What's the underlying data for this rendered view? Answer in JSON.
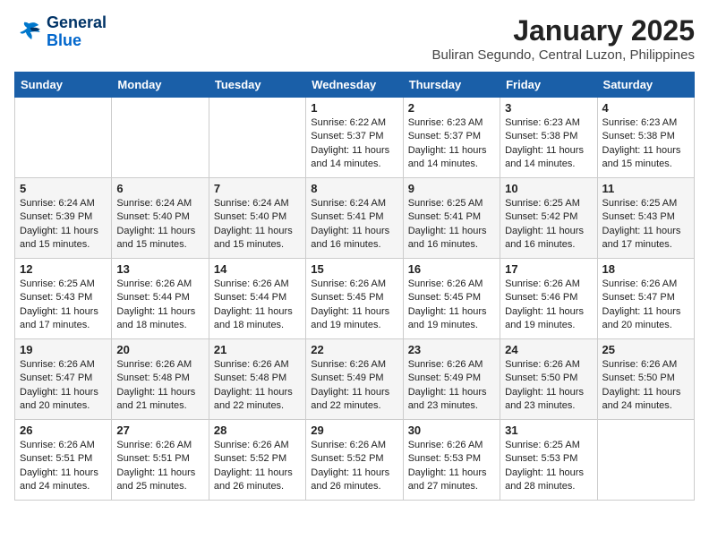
{
  "header": {
    "logo_line1": "General",
    "logo_line2": "Blue",
    "month_title": "January 2025",
    "subtitle": "Buliran Segundo, Central Luzon, Philippines"
  },
  "days_of_week": [
    "Sunday",
    "Monday",
    "Tuesday",
    "Wednesday",
    "Thursday",
    "Friday",
    "Saturday"
  ],
  "weeks": [
    [
      {
        "day": "",
        "sunrise": "",
        "sunset": "",
        "daylight": ""
      },
      {
        "day": "",
        "sunrise": "",
        "sunset": "",
        "daylight": ""
      },
      {
        "day": "",
        "sunrise": "",
        "sunset": "",
        "daylight": ""
      },
      {
        "day": "1",
        "sunrise": "6:22 AM",
        "sunset": "5:37 PM",
        "daylight": "11 hours and 14 minutes."
      },
      {
        "day": "2",
        "sunrise": "6:23 AM",
        "sunset": "5:37 PM",
        "daylight": "11 hours and 14 minutes."
      },
      {
        "day": "3",
        "sunrise": "6:23 AM",
        "sunset": "5:38 PM",
        "daylight": "11 hours and 14 minutes."
      },
      {
        "day": "4",
        "sunrise": "6:23 AM",
        "sunset": "5:38 PM",
        "daylight": "11 hours and 15 minutes."
      }
    ],
    [
      {
        "day": "5",
        "sunrise": "6:24 AM",
        "sunset": "5:39 PM",
        "daylight": "11 hours and 15 minutes."
      },
      {
        "day": "6",
        "sunrise": "6:24 AM",
        "sunset": "5:40 PM",
        "daylight": "11 hours and 15 minutes."
      },
      {
        "day": "7",
        "sunrise": "6:24 AM",
        "sunset": "5:40 PM",
        "daylight": "11 hours and 15 minutes."
      },
      {
        "day": "8",
        "sunrise": "6:24 AM",
        "sunset": "5:41 PM",
        "daylight": "11 hours and 16 minutes."
      },
      {
        "day": "9",
        "sunrise": "6:25 AM",
        "sunset": "5:41 PM",
        "daylight": "11 hours and 16 minutes."
      },
      {
        "day": "10",
        "sunrise": "6:25 AM",
        "sunset": "5:42 PM",
        "daylight": "11 hours and 16 minutes."
      },
      {
        "day": "11",
        "sunrise": "6:25 AM",
        "sunset": "5:43 PM",
        "daylight": "11 hours and 17 minutes."
      }
    ],
    [
      {
        "day": "12",
        "sunrise": "6:25 AM",
        "sunset": "5:43 PM",
        "daylight": "11 hours and 17 minutes."
      },
      {
        "day": "13",
        "sunrise": "6:26 AM",
        "sunset": "5:44 PM",
        "daylight": "11 hours and 18 minutes."
      },
      {
        "day": "14",
        "sunrise": "6:26 AM",
        "sunset": "5:44 PM",
        "daylight": "11 hours and 18 minutes."
      },
      {
        "day": "15",
        "sunrise": "6:26 AM",
        "sunset": "5:45 PM",
        "daylight": "11 hours and 19 minutes."
      },
      {
        "day": "16",
        "sunrise": "6:26 AM",
        "sunset": "5:45 PM",
        "daylight": "11 hours and 19 minutes."
      },
      {
        "day": "17",
        "sunrise": "6:26 AM",
        "sunset": "5:46 PM",
        "daylight": "11 hours and 19 minutes."
      },
      {
        "day": "18",
        "sunrise": "6:26 AM",
        "sunset": "5:47 PM",
        "daylight": "11 hours and 20 minutes."
      }
    ],
    [
      {
        "day": "19",
        "sunrise": "6:26 AM",
        "sunset": "5:47 PM",
        "daylight": "11 hours and 20 minutes."
      },
      {
        "day": "20",
        "sunrise": "6:26 AM",
        "sunset": "5:48 PM",
        "daylight": "11 hours and 21 minutes."
      },
      {
        "day": "21",
        "sunrise": "6:26 AM",
        "sunset": "5:48 PM",
        "daylight": "11 hours and 22 minutes."
      },
      {
        "day": "22",
        "sunrise": "6:26 AM",
        "sunset": "5:49 PM",
        "daylight": "11 hours and 22 minutes."
      },
      {
        "day": "23",
        "sunrise": "6:26 AM",
        "sunset": "5:49 PM",
        "daylight": "11 hours and 23 minutes."
      },
      {
        "day": "24",
        "sunrise": "6:26 AM",
        "sunset": "5:50 PM",
        "daylight": "11 hours and 23 minutes."
      },
      {
        "day": "25",
        "sunrise": "6:26 AM",
        "sunset": "5:50 PM",
        "daylight": "11 hours and 24 minutes."
      }
    ],
    [
      {
        "day": "26",
        "sunrise": "6:26 AM",
        "sunset": "5:51 PM",
        "daylight": "11 hours and 24 minutes."
      },
      {
        "day": "27",
        "sunrise": "6:26 AM",
        "sunset": "5:51 PM",
        "daylight": "11 hours and 25 minutes."
      },
      {
        "day": "28",
        "sunrise": "6:26 AM",
        "sunset": "5:52 PM",
        "daylight": "11 hours and 26 minutes."
      },
      {
        "day": "29",
        "sunrise": "6:26 AM",
        "sunset": "5:52 PM",
        "daylight": "11 hours and 26 minutes."
      },
      {
        "day": "30",
        "sunrise": "6:26 AM",
        "sunset": "5:53 PM",
        "daylight": "11 hours and 27 minutes."
      },
      {
        "day": "31",
        "sunrise": "6:25 AM",
        "sunset": "5:53 PM",
        "daylight": "11 hours and 28 minutes."
      },
      {
        "day": "",
        "sunrise": "",
        "sunset": "",
        "daylight": ""
      }
    ]
  ],
  "labels": {
    "sunrise": "Sunrise:",
    "sunset": "Sunset:",
    "daylight": "Daylight:"
  },
  "colors": {
    "header_bg": "#1a5fa8",
    "header_text": "#ffffff",
    "logo_dark": "#003366",
    "logo_blue": "#0066cc"
  }
}
